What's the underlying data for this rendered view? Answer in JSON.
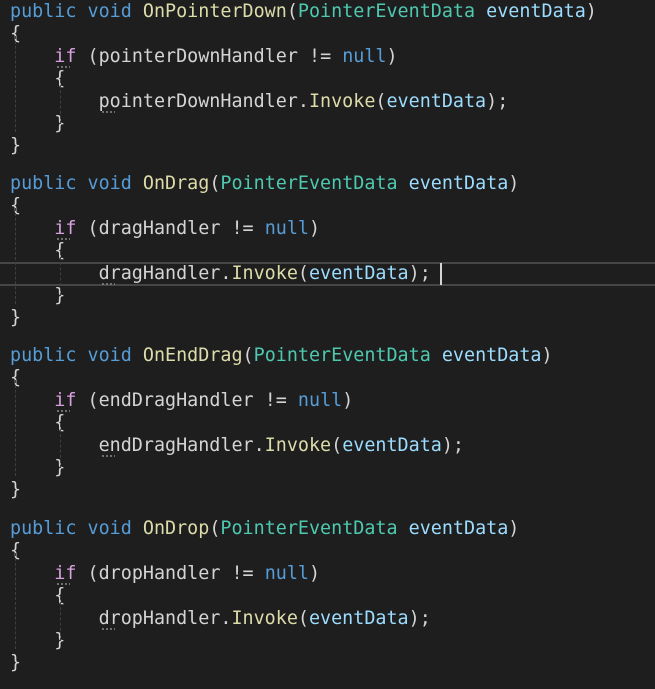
{
  "code": {
    "keywords": {
      "public": "public",
      "void": "void",
      "if": "if",
      "null": "null"
    },
    "param_type": "PointerEventData",
    "param_name": "eventData",
    "invoke": "Invoke",
    "methods": [
      {
        "name": "OnPointerDown",
        "handler": "pointerDownHandler"
      },
      {
        "name": "OnDrag",
        "handler": "dragHandler"
      },
      {
        "name": "OnEndDrag",
        "handler": "endDragHandler"
      },
      {
        "name": "OnDrop",
        "handler": "dropHandler"
      }
    ]
  },
  "theme": {
    "background": "#1e1e1e",
    "keyword": "#569cd6",
    "control_keyword": "#d8a0df",
    "method": "#dcdcaa",
    "type": "#4ec9b0",
    "parameter": "#9cdcfe",
    "text": "#d4d4d4"
  }
}
